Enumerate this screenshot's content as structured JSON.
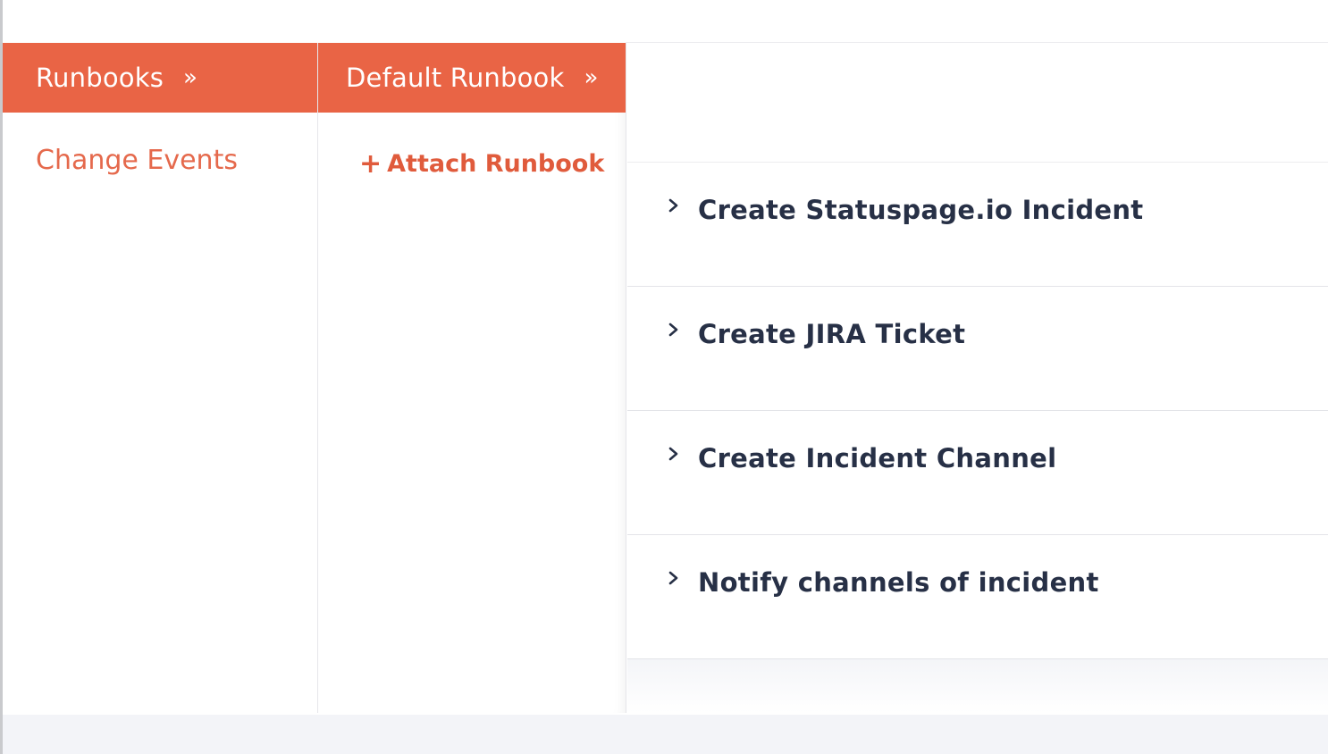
{
  "columns": {
    "first": {
      "header": "Runbooks",
      "header_chevron": "»",
      "link": "Change Events"
    },
    "second": {
      "header": "Default Runbook",
      "header_chevron": "»",
      "action_icon": "+",
      "action_label": "Attach Runbook"
    }
  },
  "steps": [
    {
      "label": "Create Statuspage.io Incident"
    },
    {
      "label": "Create JIRA Ticket"
    },
    {
      "label": "Create Incident Channel"
    },
    {
      "label": "Notify channels of incident"
    }
  ],
  "colors": {
    "accent": "#e96445",
    "link": "#e5694c",
    "step_text": "#273046"
  },
  "icons": {
    "header_chevron": "double-chevron-right-icon",
    "step_toggle": "chevron-right-icon",
    "attach": "plus-icon"
  }
}
